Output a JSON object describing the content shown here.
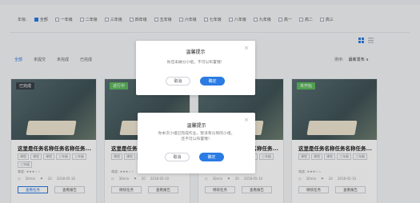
{
  "filters": {
    "label": "年级:",
    "options": [
      {
        "label": "全部",
        "checked": true
      },
      {
        "label": "一年级",
        "checked": false
      },
      {
        "label": "二年级",
        "checked": false
      },
      {
        "label": "三年级",
        "checked": false
      },
      {
        "label": "四年级",
        "checked": false
      },
      {
        "label": "五年级",
        "checked": false
      },
      {
        "label": "六年级",
        "checked": false
      },
      {
        "label": "七年级",
        "checked": false
      },
      {
        "label": "八年级",
        "checked": false
      },
      {
        "label": "九年级",
        "checked": false
      },
      {
        "label": "高一",
        "checked": false
      },
      {
        "label": "高二",
        "checked": false
      },
      {
        "label": "高三",
        "checked": false
      }
    ]
  },
  "tabs": [
    "全部",
    "未提交",
    "未完成",
    "已完成"
  ],
  "sort": {
    "label": "排序:",
    "value": "最新发布 ∨"
  },
  "cards": [
    {
      "tag": "已完成",
      "tag_color": "#3a3f47",
      "title": "这里是任务名称任务名称任务...",
      "chips": [
        "课程",
        "课程",
        "课程",
        "三年级",
        "三年级",
        "三年级"
      ],
      "meta": "难度: ★★★☆☆",
      "time": "30min",
      "count": "20",
      "date": "2018-05-10",
      "btn1": "查看任务",
      "btn2": "查看报告"
    },
    {
      "tag": "进行中",
      "tag_color": "#5cb85c",
      "title": "这里是任务名称任务名称任务...",
      "chips": [
        "课程",
        "课程",
        "课程",
        "三年级",
        "三年级"
      ],
      "meta": "难度: ★★★☆☆",
      "time": "30min",
      "count": "20",
      "date": "2018-05-10",
      "btn1": "继续任务",
      "btn2": "查看报告"
    },
    {
      "tag": "",
      "tag_color": "#2a7be4",
      "title": "这里是任务名称任务名称任务...",
      "chips": [
        "课程",
        "课程",
        "课程",
        "三年级",
        "三年级"
      ],
      "meta": "难度: ★★★☆☆",
      "time": "30min",
      "count": "20",
      "date": "2018-05-10",
      "btn1": "继续任务",
      "btn2": "查看报告"
    },
    {
      "tag": "未开始",
      "tag_color": "#5cb85c",
      "title": "这里是任务名称任务名称任务...",
      "chips": [
        "课程",
        "课程",
        "课程",
        "三年级",
        "三年级"
      ],
      "meta": "难度: ★★★☆☆",
      "time": "30min",
      "count": "20",
      "date": "2018-05-10",
      "btn1": "继续任务",
      "btn2": "查看报告"
    }
  ],
  "modal1": {
    "title": "温馨提示",
    "body": "你还未做分小组，不可以布置哦！",
    "cancel": "取消",
    "ok": "确定"
  },
  "modal2": {
    "title": "温馨提示",
    "body_line1": "你本次小组已完成作业，暂没有分到的小组，",
    "body_line2": "还不可以布置哦！",
    "cancel": "取消",
    "ok": "确定"
  },
  "colors": {
    "accent": "#2a7be4"
  }
}
